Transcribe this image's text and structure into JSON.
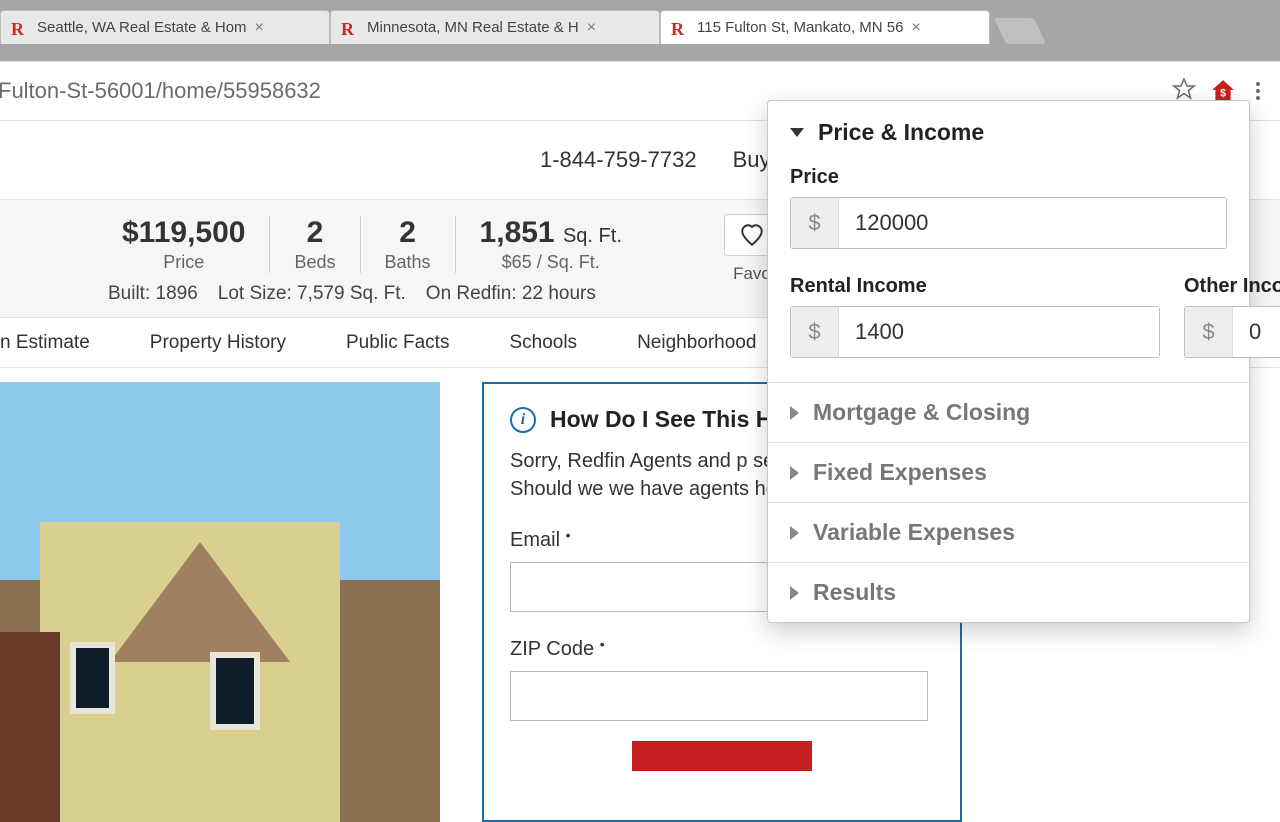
{
  "browser": {
    "tabs": [
      {
        "title": "Seattle, WA Real Estate & Hom",
        "active": false
      },
      {
        "title": "Minnesota, MN Real Estate & H",
        "active": false
      },
      {
        "title": "115 Fulton St, Mankato, MN 56",
        "active": true
      }
    ],
    "url_fragment": "Fulton-St-56001/home/55958632"
  },
  "header": {
    "phone": "1-844-759-7732",
    "nav_buy": "Buy"
  },
  "property": {
    "price": "$119,500",
    "price_label": "Price",
    "beds": "2",
    "beds_label": "Beds",
    "baths": "2",
    "baths_label": "Baths",
    "sqft": "1,851",
    "sqft_unit": "Sq. Ft.",
    "price_per_sqft": "$65 / Sq. Ft.",
    "built": "Built: 1896",
    "lot": "Lot Size: 7,579 Sq. Ft.",
    "on_redfin": "On Redfin: 22 hours",
    "favorite_label": "Favo"
  },
  "subnav": {
    "estimate": "n Estimate",
    "history": "Property History",
    "facts": "Public Facts",
    "schools": "Schools",
    "neighborhood": "Neighborhood"
  },
  "info_panel": {
    "heading": "How Do I See This Ho",
    "body": "Sorry, Redfin Agents and p serve this area. Should we we have agents here?",
    "email_label": "Email",
    "zip_label": "ZIP Code"
  },
  "extension": {
    "section_open": "Price & Income",
    "price_label": "Price",
    "price_value": "120000",
    "rental_label": "Rental Income",
    "rental_value": "1400",
    "other_label": "Other Income",
    "other_value": "0",
    "sections_collapsed": [
      "Mortgage & Closing",
      "Fixed Expenses",
      "Variable Expenses",
      "Results"
    ]
  }
}
